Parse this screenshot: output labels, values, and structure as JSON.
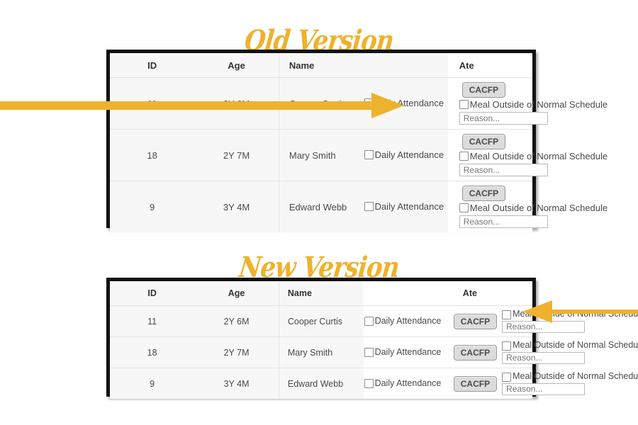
{
  "sections": [
    {
      "id": "old",
      "title": "Old Version",
      "title_color": "#efb22c",
      "columns": [
        "ID",
        "Age",
        "Name",
        "",
        "Ate"
      ],
      "rows": [
        {
          "id": "11",
          "age": "2Y 6M",
          "name": "Cooper Curtis",
          "attendance_label": "Daily Attendance",
          "attendance_checked": false,
          "cacfp_label": "CACFP",
          "meal_label": "Meal Outside of Normal Schedule",
          "meal_checked": false,
          "reason_placeholder": "Reason...",
          "reason_value": ""
        },
        {
          "id": "18",
          "age": "2Y 7M",
          "name": "Mary Smith",
          "attendance_label": "Daily Attendance",
          "attendance_checked": false,
          "cacfp_label": "CACFP",
          "meal_label": "Meal Outside of Normal Schedule",
          "meal_checked": false,
          "reason_placeholder": "Reason...",
          "reason_value": ""
        },
        {
          "id": "9",
          "age": "3Y 4M",
          "name": "Edward Webb",
          "attendance_label": "Daily Attendance",
          "attendance_checked": false,
          "cacfp_label": "CACFP",
          "meal_label": "Meal Outside of Normal Schedule",
          "meal_checked": false,
          "reason_placeholder": "Reason...",
          "reason_value": ""
        }
      ]
    },
    {
      "id": "new",
      "title": "New Version",
      "title_color": "#efb22c",
      "columns": [
        "ID",
        "Age",
        "Name",
        "",
        "Ate"
      ],
      "rows": [
        {
          "id": "11",
          "age": "2Y 6M",
          "name": "Cooper Curtis",
          "attendance_label": "Daily Attendance",
          "attendance_checked": false,
          "cacfp_label": "CACFP",
          "meal_label": "Meal Outside of Normal Schedule",
          "meal_checked": false,
          "reason_placeholder": "Reason...",
          "reason_value": ""
        },
        {
          "id": "18",
          "age": "2Y 7M",
          "name": "Mary Smith",
          "attendance_label": "Daily Attendance",
          "attendance_checked": false,
          "cacfp_label": "CACFP",
          "meal_label": "Meal Outside of Normal Schedule",
          "meal_checked": false,
          "reason_placeholder": "Reason...",
          "reason_value": ""
        },
        {
          "id": "9",
          "age": "3Y 4M",
          "name": "Edward Webb",
          "attendance_label": "Daily Attendance",
          "attendance_checked": false,
          "cacfp_label": "CACFP",
          "meal_label": "Meal Outside of Normal Schedule",
          "meal_checked": false,
          "reason_placeholder": "Reason...",
          "reason_value": ""
        }
      ]
    }
  ],
  "annotations": {
    "arrow_color": "#efb22c",
    "arrow_old_direction": "right",
    "arrow_new_direction": "left"
  }
}
